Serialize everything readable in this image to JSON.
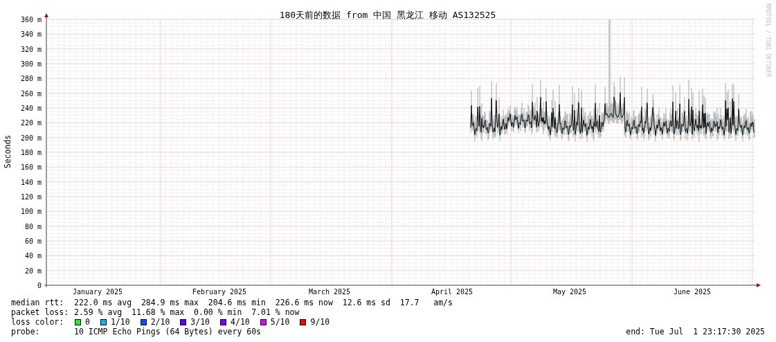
{
  "chart": {
    "title": "180天前的数据 from 中国 黑龙江 移动 AS132525",
    "ylabel": "Seconds",
    "yticks": [
      "360 m",
      "340 m",
      "320 m",
      "300 m",
      "280 m",
      "260 m",
      "240 m",
      "220 m",
      "200 m",
      "180 m",
      "160 m",
      "140 m",
      "120 m",
      "100 m",
      "80 m",
      "60 m",
      "40 m",
      "20 m",
      "0"
    ],
    "months": [
      "January 2025",
      "February 2025",
      "March 2025",
      "April 2025",
      "May 2025",
      "June 2025"
    ],
    "side_text": "RRDTOOL / TOBI OETIKER"
  },
  "legend": {
    "median_rtt": {
      "label": "median rtt:",
      "value": "222.0 ms avg  284.9 ms max  204.6 ms min  226.6 ms now  12.6 ms sd  17.7   am/s"
    },
    "packet_loss": {
      "label": "packet loss:",
      "value": "2.59 % avg  11.68 % max  0.00 % min  7.01 % now"
    },
    "loss_color": {
      "label": "loss color:",
      "items": [
        {
          "label": "0",
          "color": "#22ee22"
        },
        {
          "label": "1/10",
          "color": "#00b8ff"
        },
        {
          "label": "2/10",
          "color": "#0059ff"
        },
        {
          "label": "3/10",
          "color": "#5e00ff"
        },
        {
          "label": "4/10",
          "color": "#7e00ff"
        },
        {
          "label": "5/10",
          "color": "#dd00ff"
        },
        {
          "label": "9/10",
          "color": "#ff0000"
        }
      ]
    },
    "probe": {
      "label": "probe:",
      "value": "10 ICMP Echo Pings (64 Bytes) every 60s"
    },
    "end": "end: Tue Jul  1 23:17:30 2025"
  }
}
